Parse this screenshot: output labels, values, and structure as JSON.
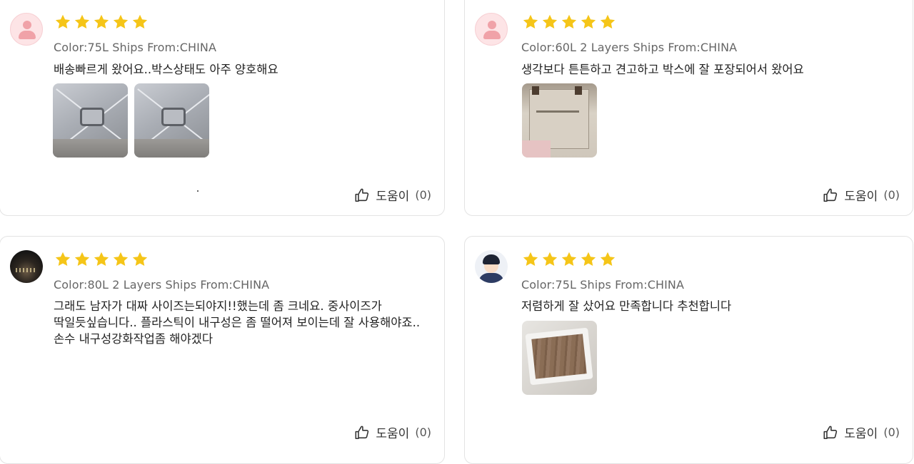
{
  "colors": {
    "star": "#F5C518",
    "border": "#E3E3E3",
    "variant_text": "#666666"
  },
  "reviews": [
    {
      "avatar": "default-user-icon",
      "rating": 5,
      "variant": "Color:75L Ships From:CHINA",
      "text": "배송빠르게 왔어요..박스상태도 아주 양호해요",
      "photos": 2,
      "helpful_label": "도움이",
      "helpful_count": "(0)"
    },
    {
      "avatar": "default-user-icon",
      "rating": 5,
      "variant": "Color:60L 2 Layers Ships From:CHINA",
      "text": "생각보다 튼튼하고 견고하고 박스에 잘 포장되어서 왔어요",
      "photos": 1,
      "helpful_label": "도움이",
      "helpful_count": "(0)"
    },
    {
      "avatar": "night-scene-avatar",
      "rating": 5,
      "variant": "Color:80L 2 Layers Ships From:CHINA",
      "text": "그래도 남자가 대짜 사이즈는되야지!!했는데 좀 크네요. 중사이즈가 딱일듯싶습니다.. 플라스틱이 내구성은 좀 떨어져 보이는데 잘 사용해야죠.. 손수 내구성강화작업좀 해야겠다",
      "photos": 0,
      "helpful_label": "도움이",
      "helpful_count": "(0)"
    },
    {
      "avatar": "cartoon-man-avatar",
      "rating": 5,
      "variant": "Color:75L Ships From:CHINA",
      "text": "저렴하게 잘 샀어요 만족합니다 추천합니다",
      "photos": 1,
      "helpful_label": "도움이",
      "helpful_count": "(0)"
    }
  ]
}
